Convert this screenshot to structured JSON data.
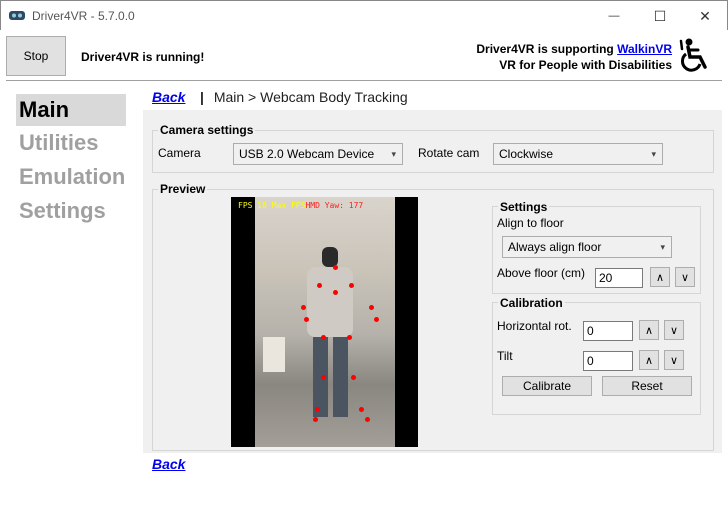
{
  "window": {
    "title": "Driver4VR - 5.7.0.0"
  },
  "header": {
    "stop_label": "Stop",
    "status": "Driver4VR is running!",
    "support_prefix": "Driver4VR is supporting ",
    "support_link": "WalkinVR",
    "support_line2": "VR for People with Disabilities"
  },
  "sidebar": {
    "items": [
      {
        "label": "Main",
        "active": true
      },
      {
        "label": "Utilities",
        "active": false
      },
      {
        "label": "Emulation",
        "active": false
      },
      {
        "label": "Settings",
        "active": false
      }
    ]
  },
  "breadcrumb": {
    "back_label": "Back",
    "separator": "|",
    "path": "Main > Webcam Body Tracking"
  },
  "camera_settings": {
    "title": "Camera settings",
    "camera_label": "Camera",
    "camera_value": "USB 2.0 Webcam Device",
    "rotate_label": "Rotate cam",
    "rotate_value": "Clockwise"
  },
  "preview": {
    "title": "Preview",
    "overlay_fps": "FPS 18 Max FPS",
    "overlay_hmd": "HMD Yaw: 177"
  },
  "settings": {
    "title": "Settings",
    "align_label": "Align to floor",
    "align_value": "Always align floor",
    "above_floor_label": "Above floor (cm)",
    "above_floor_value": "20"
  },
  "calibration": {
    "title": "Calibration",
    "horizontal_label": "Horizontal rot.",
    "horizontal_value": "0",
    "tilt_label": "Tilt",
    "tilt_value": "0",
    "calibrate_label": "Calibrate",
    "reset_label": "Reset"
  },
  "footer": {
    "back_label": "Back"
  },
  "icons": {
    "up": "∧",
    "down": "∨",
    "minimize": "—",
    "maximize": "☐",
    "close": "✕",
    "dropdown": "▾"
  },
  "colors": {
    "link": "#0000ee",
    "keypoint": "#ff0000",
    "overlay_text": "#ffff00"
  }
}
